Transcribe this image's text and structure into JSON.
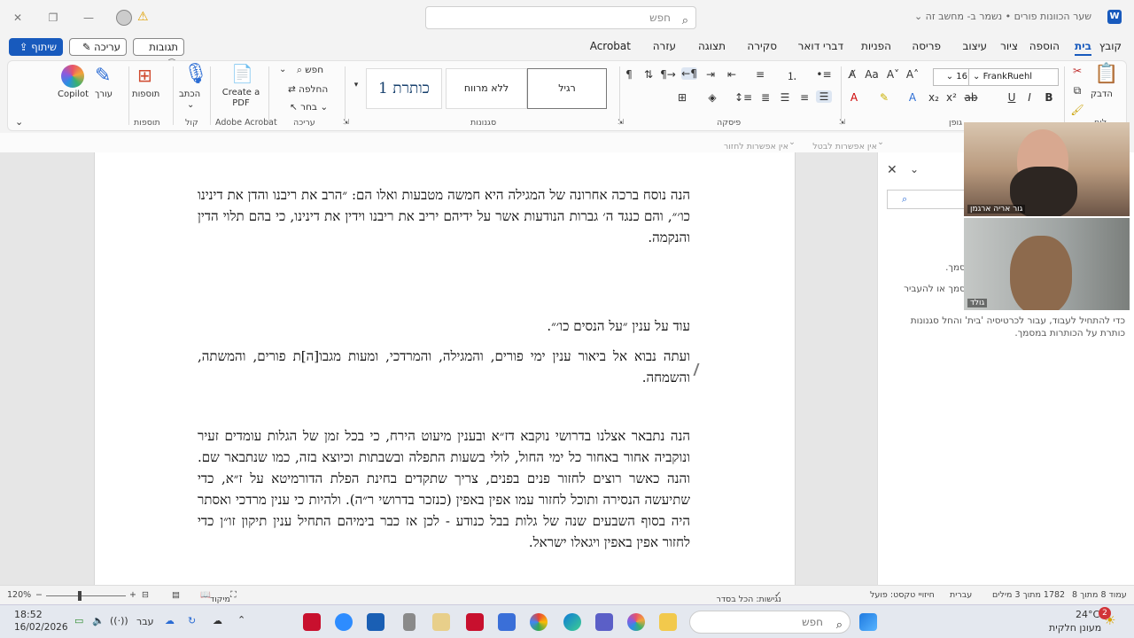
{
  "titlebar": {
    "doc_title": "שער הכוונות פורים • נשמר ב- מחשב זה ⌄",
    "search_placeholder": "חפש",
    "warning_icon": "warning-icon",
    "account_icon": "account-icon"
  },
  "menu": {
    "tabs": [
      "קובץ",
      "בית",
      "הוספה",
      "ציור",
      "עיצוב",
      "פריסה",
      "הפניות",
      "דברי דואר",
      "סקירה",
      "תצוגה",
      "עזרה",
      "Acrobat"
    ],
    "active": "בית"
  },
  "top_buttons": {
    "share": "שיתוף",
    "edit": "עריכה",
    "comments": "תגובות"
  },
  "ribbon": {
    "clipboard_label": "לוח",
    "paste_label": "הדבק",
    "font_group_label": "גופן",
    "font_name": "FrankRuehl",
    "font_size": "16",
    "paragraph_label": "פיסקה",
    "styles_label": "סגנונות",
    "styles": [
      "רגיל",
      "ללא מרווח",
      "כותרת 1"
    ],
    "editing_label": "עריכה",
    "find": "חפש",
    "replace": "החלפה",
    "select": "בחר",
    "acrobat_label": "Adobe Acrobat",
    "create_pdf": "Create a PDF",
    "voice_label": "קול",
    "dictate": "הכתב",
    "addins_label": "תוספות",
    "addins": "תוספות",
    "editor": "עורך",
    "copilot": "Copilot"
  },
  "quickbar": {
    "item1": "אין אפשרות לבטל",
    "item2": "אין אפשרות לחזור"
  },
  "document": {
    "paragraphs": [
      "הנה נוסח ברכה אחרונה של המגילה היא חמשה מטבעות ואלו הם: ״הרב את ריבנו והדן את דינינו כו׳״, והם כנגד ה׳ גברות הנודעות אשר על ידיהם יריב את ריבנו וידין את דינינו, כי בהם תלוי הדין והנקמה.",
      "עוד על ענין ״על הנסים כו׳״.",
      "ועתה נבוא אל ביאור ענין ימי פורים, והמגילה, והמרדכי, ומעות מגבו[ה]ת פורים, והמשתה, והשמחה.",
      "הנה נתבאר אצלנו בדרושי נוקבא דז״א ובענין מיעוט הירח, כי בכל זמן של הגלות עומדים זעיר ונוקביה אחור באחור כל ימי החול, לולי בשעות התפלה ובשבתות וכיוצא בזה, כמו שנתבאר שם. והנה כאשר רוצים לחזור פנים בפנים, צריך שתקדים בחינת הפלת הדורמיטא על ז״א, כדי שתיעשה הנסירה ותוכל לחזור עמו אפין באפין (כנזכר בדרושי ר״ה). ולהיות כי ענין מרדכי ואסתר היה בסוף השבעים שנה של גלות בבל כנודע - לכן אז כבר בימיהם התחיל ענין תיקון זו״ן כדי לחזור אפין באפין ויגאלו ישראל."
    ]
  },
  "sidepane": {
    "text1": "סמך.",
    "text2": "סמך או להעביר",
    "text3": "כדי להתחיל לעבוד, עבור לכרטיסיה 'בית' והחל סגנונות",
    "text4": "כותרת על הכותרות במסמך."
  },
  "video": {
    "participant1": "גור אריה ארגמן",
    "participant2": "גולד"
  },
  "statusbar": {
    "page": "עמוד 8 מתוך 8",
    "words": "1782 מתוך 3 מילים",
    "language": "עברית",
    "predictions": "חיזויי טקסט: פועל",
    "accessibility": "נגישות: הכל בסדר",
    "focus": "מיקוד",
    "zoom": "120%",
    "zoom_fraction": 0.42
  },
  "taskbar": {
    "search_placeholder": "חפש",
    "weather_temp": "24°C",
    "weather_desc": "מעונן חלקית",
    "weather_badge": "2",
    "time": "18:52",
    "date": "16/02/2026",
    "lang": "עבר"
  }
}
